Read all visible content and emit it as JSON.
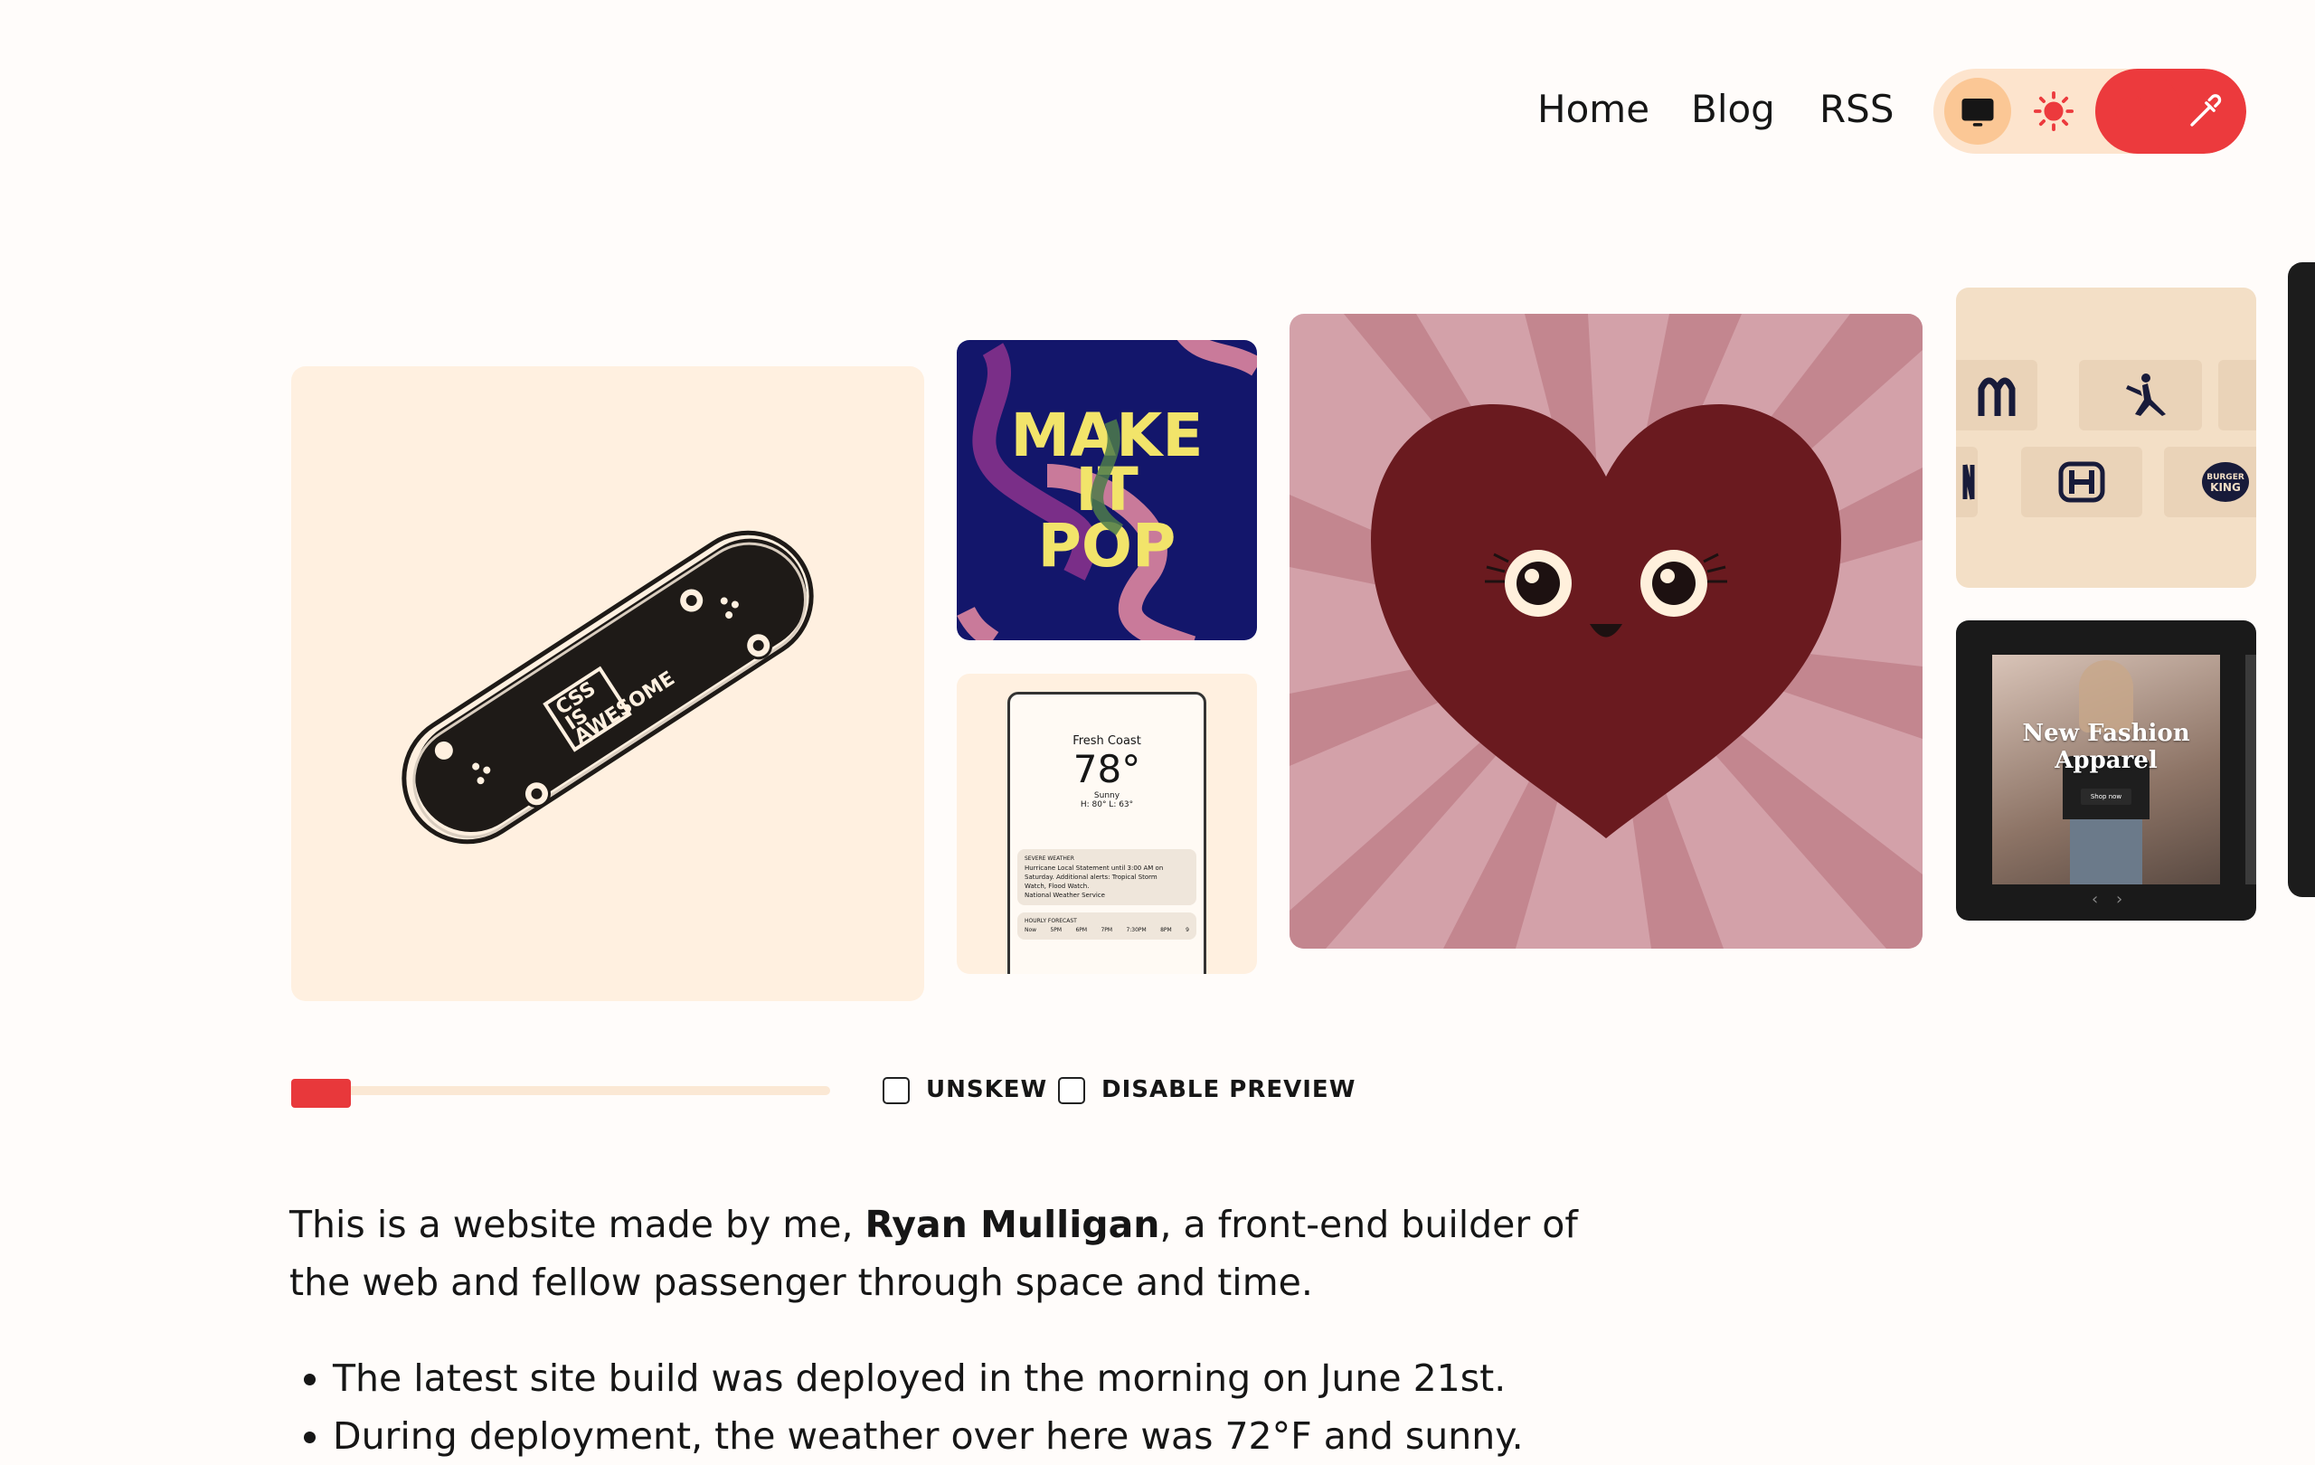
{
  "nav": {
    "links": [
      "Home",
      "Blog",
      "RSS"
    ]
  },
  "theme_switcher": {
    "options": [
      "monitor-icon",
      "sun-icon",
      "moon-stars-icon",
      "eyedropper-icon"
    ],
    "active": "monitor-icon",
    "accent": "#ec3a3d",
    "pill_bg": "#fde4cd"
  },
  "gallery": {
    "make_it_pop": {
      "lines": [
        "MAKE",
        "IT",
        "POP"
      ]
    },
    "skateboard": {
      "deck_text": [
        "CSS",
        "IS",
        "AWESOME"
      ]
    },
    "weather": {
      "location": "Fresh Coast",
      "temp": "78°",
      "condition": "Sunny",
      "hilo": "H: 80°  L: 63°",
      "alert_title": "SEVERE WEATHER",
      "alert_lines": [
        "Hurricane Local Statement until 3:00 AM on",
        "Saturday. Additional alerts: Tropical Storm",
        "Watch, Flood Watch."
      ],
      "alert_source": "National Weather Service",
      "forecast_title": "HOURLY FORECAST",
      "forecast_times": [
        "Now",
        "5PM",
        "6PM",
        "7PM",
        "7:30PM",
        "8PM",
        "9"
      ]
    },
    "logos": {
      "burger_king": [
        "BURGER",
        "KING"
      ]
    },
    "fashion": {
      "title_lines": [
        "New Fashion",
        "Apparel"
      ],
      "cta": "Shop now",
      "pager": [
        "‹",
        "›"
      ]
    }
  },
  "controls": {
    "slider_value": 0,
    "unskew_label": "UNSKEW",
    "unskew_checked": false,
    "disable_preview_label": "DISABLE PREVIEW",
    "disable_preview_checked": false
  },
  "intro": {
    "before": "This is a website made by me, ",
    "name": "Ryan Mulligan",
    "after": ", a front-end builder of the web and fellow passenger through space and time."
  },
  "facts": [
    "The latest site build was deployed in the morning on June 21st.",
    "During deployment, the weather over here was 72°F and sunny."
  ]
}
